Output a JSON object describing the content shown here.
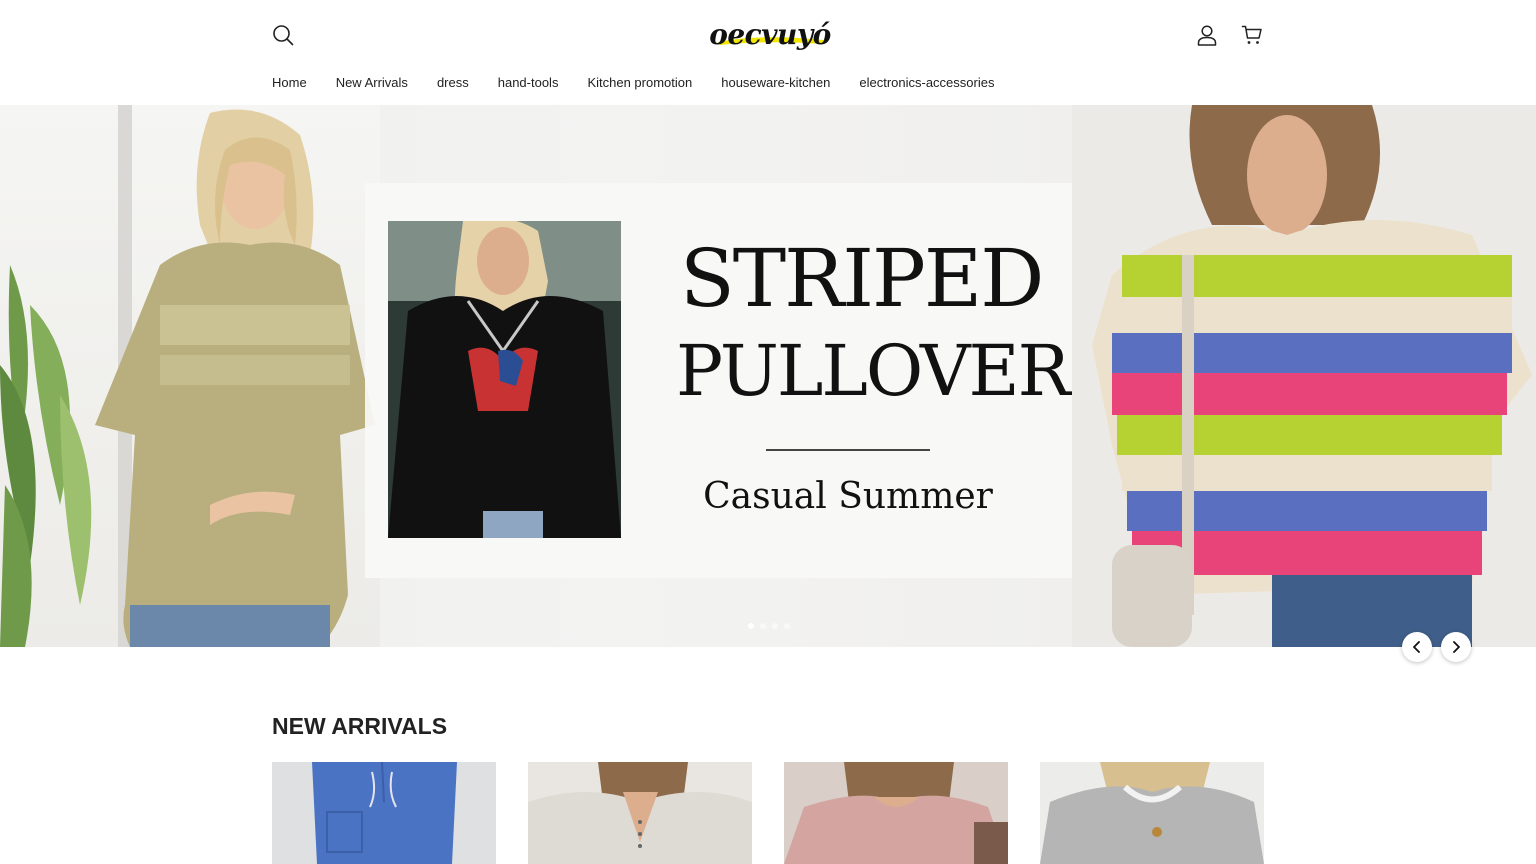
{
  "header": {
    "logo_text": "oecvuyó",
    "nav": [
      {
        "label": "Home"
      },
      {
        "label": "New Arrivals"
      },
      {
        "label": "dress"
      },
      {
        "label": "hand-tools"
      },
      {
        "label": "Kitchen promotion"
      },
      {
        "label": "houseware-kitchen"
      },
      {
        "label": "electronics-accessories"
      }
    ],
    "icons": [
      "search-icon",
      "account-icon",
      "cart-icon"
    ]
  },
  "hero": {
    "title_line1": "STRIPED",
    "title_line2": "PULLOVER",
    "subtitle": "Casual Summer",
    "slide_count": 4,
    "active_slide": 1
  },
  "new_arrivals": {
    "title": "NEW ARRIVALS",
    "products": [
      {
        "image": "blue-pants"
      },
      {
        "image": "white-henley-top"
      },
      {
        "image": "pink-sweatshirt"
      },
      {
        "image": "grey-knit-sweater"
      }
    ]
  },
  "colors": {
    "text": "#222222",
    "logo_accent": "#f2e600",
    "stripe_pink": "#e8447a",
    "stripe_green": "#b6d232",
    "stripe_blue": "#5b6fc0"
  }
}
